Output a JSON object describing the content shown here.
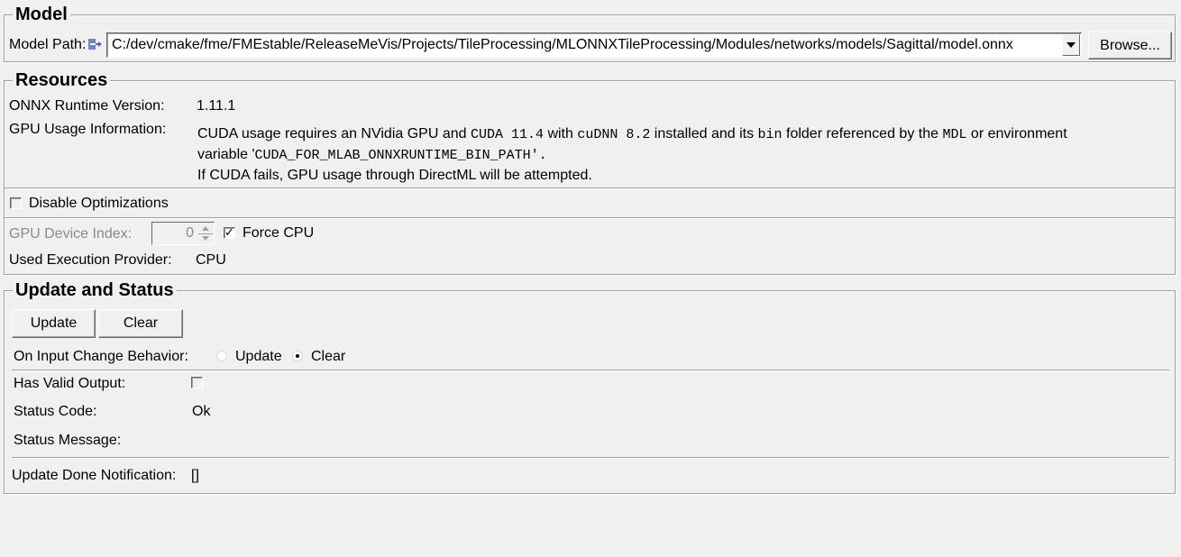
{
  "model": {
    "title": "Model",
    "path_label": "Model Path:",
    "path_value": "C:/dev/cmake/fme/FMEstable/ReleaseMeVis/Projects/TileProcessing/MLONNXTileProcessing/Modules/networks/models/Sagittal/model.onnx",
    "browse_label": "Browse...",
    "field_connector_icon": "arrow-right-icon",
    "dropdown_icon": "triangle-down-icon"
  },
  "resources": {
    "title": "Resources",
    "onnx_version_label": "ONNX Runtime Version:",
    "onnx_version_value": "1.11.1",
    "gpu_info_label": "GPU Usage Information:",
    "gpu_info": {
      "line1_a": "CUDA usage requires an NVidia GPU and ",
      "line1_code1": "CUDA 11.4",
      "line1_b": " with ",
      "line1_code2": "cuDNN 8.2",
      "line1_c": " installed and its ",
      "line1_code3": "bin",
      "line1_d": " folder referenced by the ",
      "line1_code4": "MDL",
      "line1_e": " or environment",
      "line2_a": "variable '",
      "line2_code": "CUDA_FOR_MLAB_ONNXRUNTIME_BIN_PATH",
      "line2_b": "'.",
      "line3": "If CUDA fails, GPU usage through DirectML will be attempted."
    },
    "disable_optimizations_label": "Disable Optimizations",
    "disable_optimizations_checked": false,
    "gpu_device_index_label": "GPU Device Index:",
    "gpu_device_index_value": "0",
    "force_cpu_label": "Force CPU",
    "force_cpu_checked": true,
    "execution_provider_label": "Used Execution Provider:",
    "execution_provider_value": "CPU"
  },
  "update_status": {
    "title": "Update and Status",
    "update_button": "Update",
    "clear_button": "Clear",
    "on_input_change_label": "On Input Change Behavior:",
    "radio_options": [
      "Update",
      "Clear"
    ],
    "radio_selected": "Clear",
    "has_valid_output_label": "Has Valid Output:",
    "has_valid_output_checked": false,
    "status_code_label": "Status Code:",
    "status_code_value": "Ok",
    "status_message_label": "Status Message:",
    "status_message_value": "",
    "update_done_label": "Update Done Notification:",
    "update_done_value": "[]"
  }
}
